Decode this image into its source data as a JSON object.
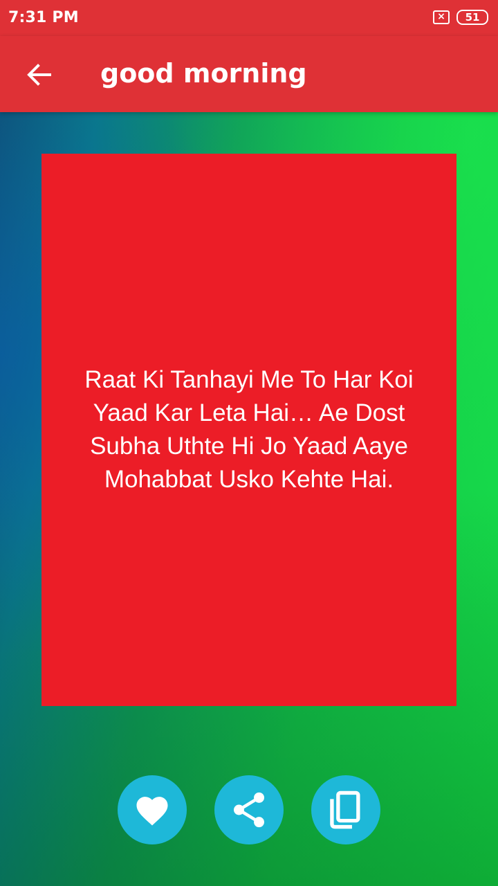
{
  "status_bar": {
    "time": "7:31 PM",
    "battery": "51",
    "sim_icon": "sim-missing-icon"
  },
  "app_bar": {
    "title": "good morning",
    "back_icon": "arrow-back-icon"
  },
  "quote": {
    "text": "Raat Ki Tanhayi Me To Har Koi Yaad Kar Leta Hai… Ae Dost Subha Uthte Hi Jo Yaad Aaye Mohabbat Usko Kehte Hai.",
    "card_color": "#ec1d27"
  },
  "actions": [
    {
      "name": "favorite",
      "icon": "heart-icon"
    },
    {
      "name": "share",
      "icon": "share-icon"
    },
    {
      "name": "copy",
      "icon": "copy-icon"
    }
  ],
  "colors": {
    "primary": "#df3136",
    "action_button": "#1eb8d8"
  }
}
